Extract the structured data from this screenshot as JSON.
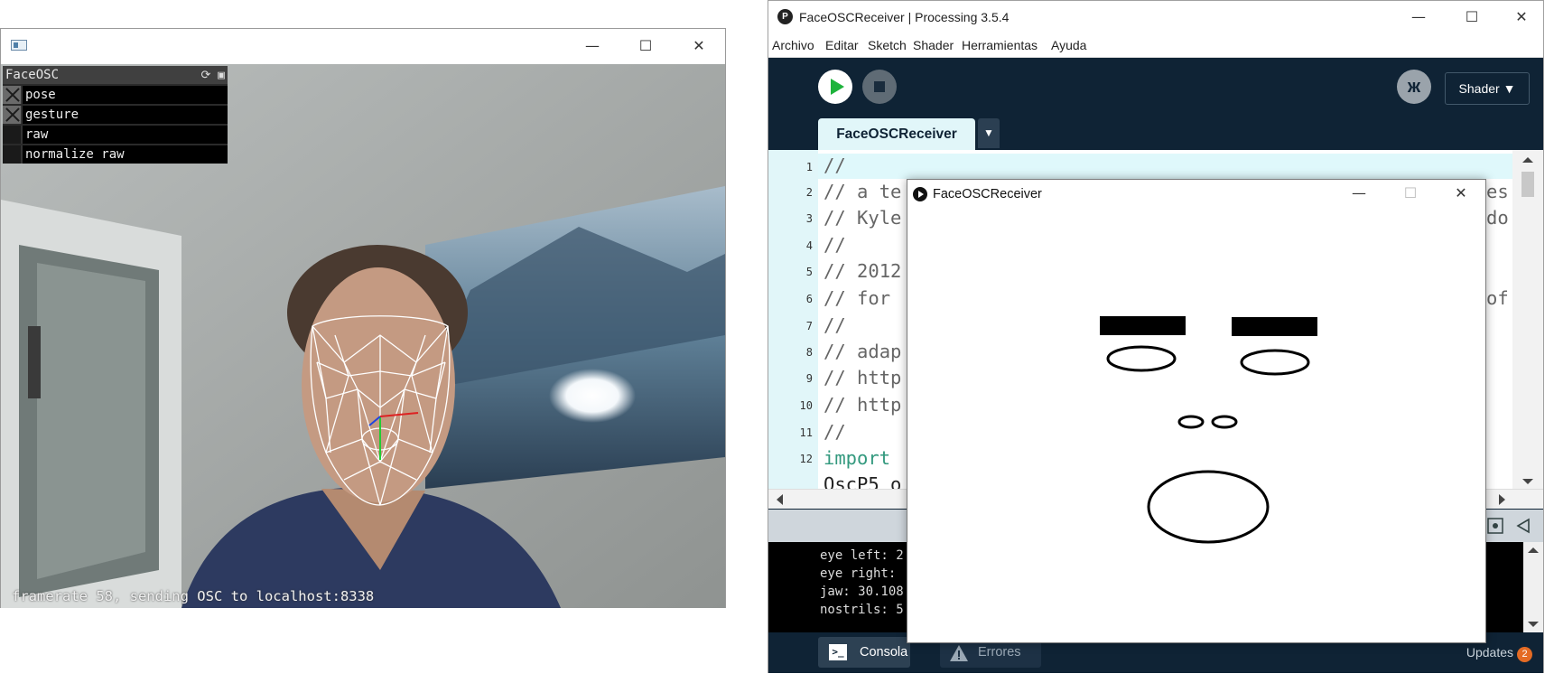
{
  "faceosc_window": {
    "panel": {
      "title": "FaceOSC",
      "header_icons": [
        "refresh-icon",
        "save-icon"
      ],
      "toggles": [
        {
          "label": "pose",
          "checked": true
        },
        {
          "label": "gesture",
          "checked": true
        },
        {
          "label": "raw",
          "checked": false
        },
        {
          "label": "normalize raw",
          "checked": false
        }
      ]
    },
    "status": "framerate 58, sending OSC to localhost:8338",
    "controls": {
      "minimize": "—",
      "maximize": "☐",
      "close": "✕"
    }
  },
  "ide": {
    "title": "FaceOSCReceiver | Processing 3.5.4",
    "menu": [
      "Archivo",
      "Editar",
      "Sketch",
      "Shader",
      "Herramientas",
      "Ayuda"
    ],
    "mode_button": "Shader",
    "mode_arrow": "▼",
    "mode_icon": "butterfly-icon",
    "tab": "FaceOSCReceiver",
    "tab_arrow": "▼",
    "line_numbers": [
      "1",
      "2",
      "3",
      "4",
      "5",
      "6",
      "7",
      "8",
      "9",
      "10",
      "11",
      "12"
    ],
    "code_lines": [
      {
        "text": "//",
        "kind": "comment"
      },
      {
        "text": "// a te",
        "kind": "comment"
      },
      {
        "text": "// Kyle",
        "kind": "comment"
      },
      {
        "text": "//",
        "kind": "comment"
      },
      {
        "text": "// 2012",
        "kind": "comment"
      },
      {
        "text": "// for",
        "kind": "comment"
      },
      {
        "text": "//",
        "kind": "comment"
      },
      {
        "text": "// adap",
        "kind": "comment"
      },
      {
        "text": "// http",
        "kind": "comment"
      },
      {
        "text": "// http",
        "kind": "comment"
      },
      {
        "text": "//",
        "kind": "comment"
      },
      {
        "text": "import",
        "kind": "keyword"
      },
      {
        "text": "OscP5 o",
        "kind": "code"
      }
    ],
    "right_fragments": [
      {
        "line": 2,
        "text": "es"
      },
      {
        "line": 3,
        "text": "do"
      },
      {
        "line": 6,
        "text": "of"
      }
    ],
    "console_lines": [
      "eye left: 2",
      "eye right:",
      "jaw: 30.108",
      "nostrils: 5"
    ],
    "status_tabs": [
      {
        "label": "Consola",
        "icon": "console-icon",
        "active": true
      },
      {
        "label": "Errores",
        "icon": "warning-icon",
        "active": false
      }
    ],
    "updates": {
      "label": "Updates",
      "count": "2"
    },
    "controls": {
      "minimize": "—",
      "maximize": "☐",
      "close": "✕"
    }
  },
  "sketch_window": {
    "title": "FaceOSCReceiver",
    "controls": {
      "minimize": "—",
      "maximize": "☐",
      "close": "✕"
    }
  }
}
